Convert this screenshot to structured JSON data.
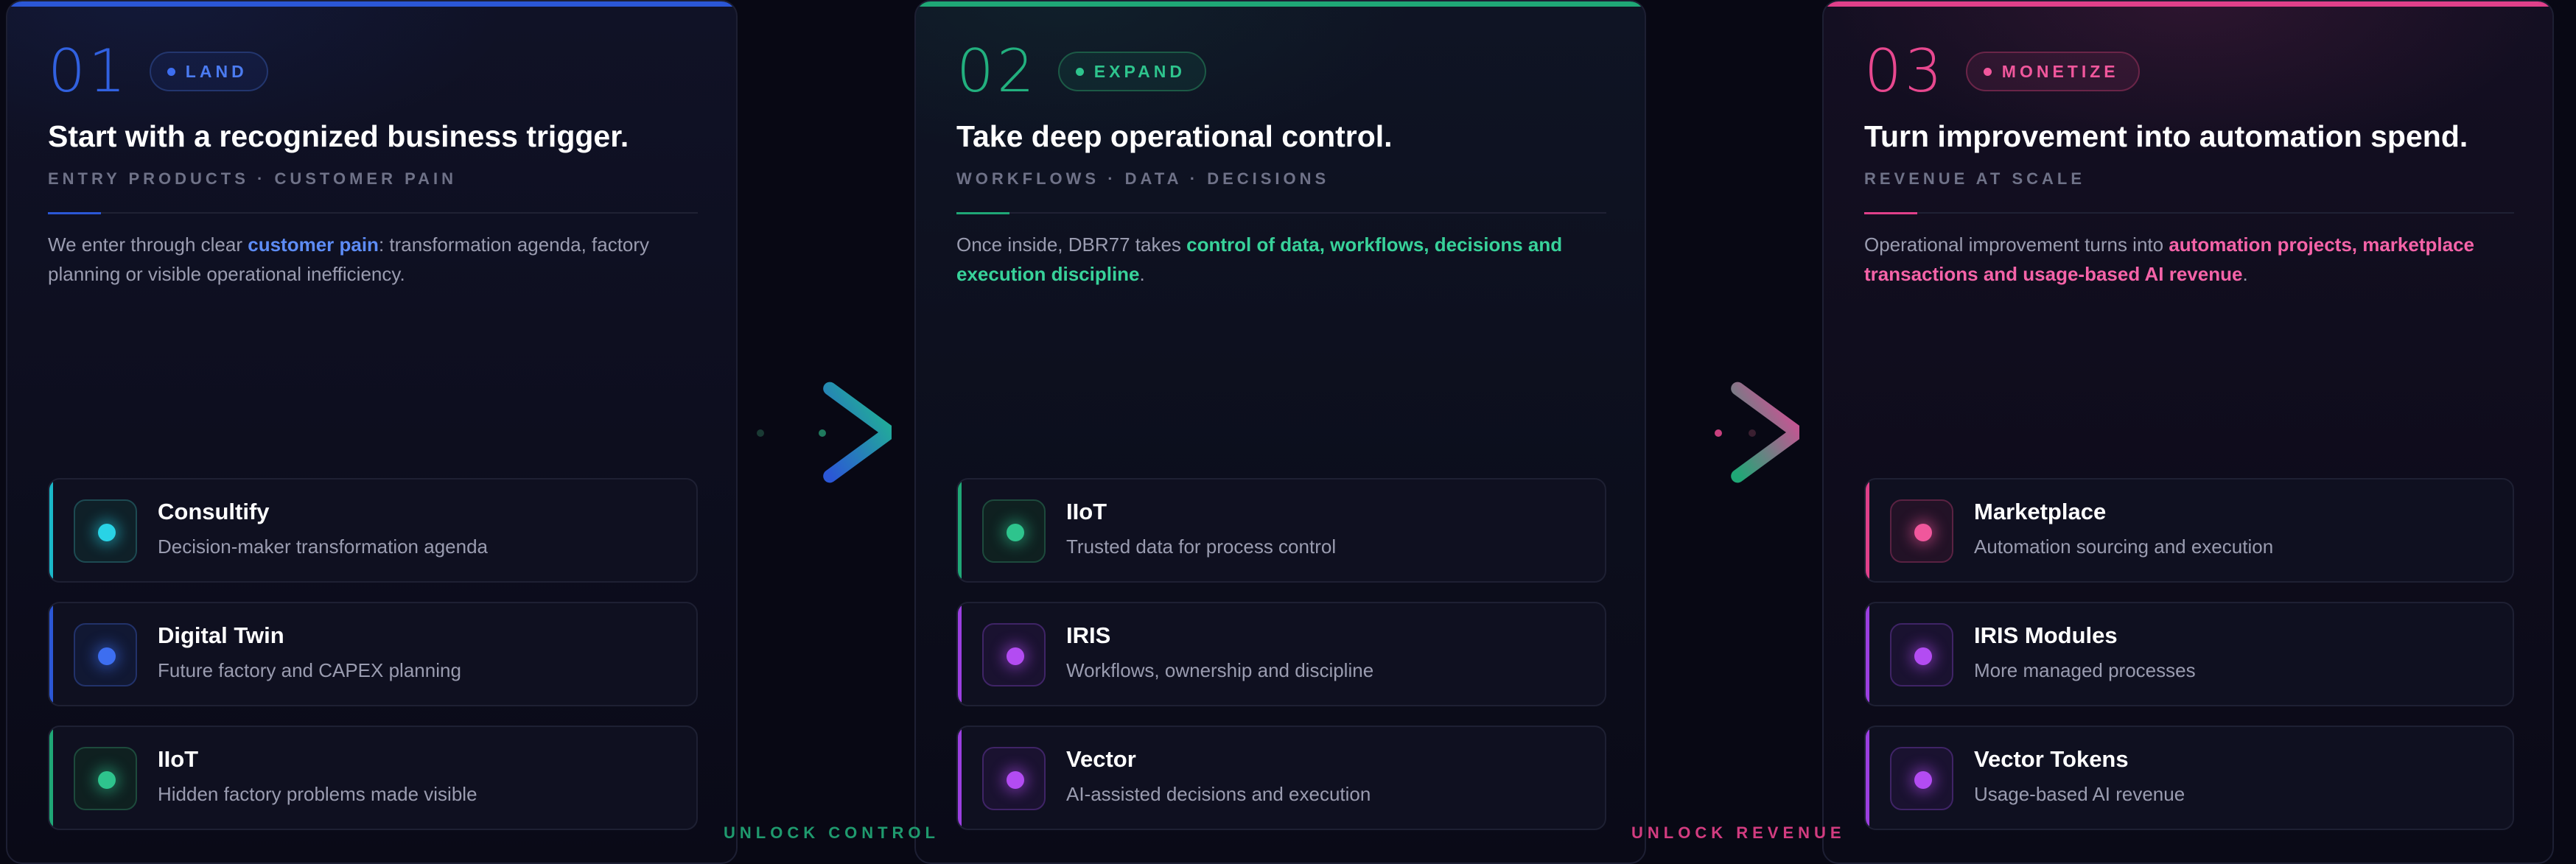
{
  "stages": [
    {
      "number": "01",
      "badge": "LAND",
      "title": "Start with a recognized business trigger.",
      "subtitle": "ENTRY PRODUCTS · CUSTOMER PAIN",
      "desc_pre": "We enter through clear ",
      "desc_hl": "customer pain",
      "desc_post": ": transformation agenda, factory planning or visible operational inefficiency.",
      "accent": "#2b57d6",
      "items": [
        {
          "name": "Consultify",
          "sub": "Decision-maker transformation agenda",
          "color": "cyan"
        },
        {
          "name": "Digital Twin",
          "sub": "Future factory and CAPEX planning",
          "color": "blue"
        },
        {
          "name": "IIoT",
          "sub": "Hidden factory problems made visible",
          "color": "green"
        }
      ]
    },
    {
      "number": "02",
      "badge": "EXPAND",
      "title": "Take deep operational control.",
      "subtitle": "WORKFLOWS · DATA · DECISIONS",
      "desc_pre": "Once inside, DBR77 takes ",
      "desc_hl": "control of data, workflows, decisions and execution discipline",
      "desc_post": ".",
      "accent": "#1fa776",
      "items": [
        {
          "name": "IIoT",
          "sub": "Trusted data for process control",
          "color": "green"
        },
        {
          "name": "IRIS",
          "sub": "Workflows, ownership and discipline",
          "color": "purple"
        },
        {
          "name": "Vector",
          "sub": "AI-assisted decisions and execution",
          "color": "purple"
        }
      ]
    },
    {
      "number": "03",
      "badge": "MONETIZE",
      "title": "Turn improvement into automation spend.",
      "subtitle": "REVENUE AT SCALE",
      "desc_pre": "Operational improvement turns into ",
      "desc_hl": "automation projects, marketplace transactions and usage-based AI revenue",
      "desc_post": ".",
      "accent": "#e0408a",
      "items": [
        {
          "name": "Marketplace",
          "sub": "Automation sourcing and execution",
          "color": "pink"
        },
        {
          "name": "IRIS Modules",
          "sub": "More managed processes",
          "color": "purple"
        },
        {
          "name": "Vector Tokens",
          "sub": "Usage-based AI revenue",
          "color": "purple"
        }
      ]
    }
  ],
  "connectors": [
    {
      "label": "UNLOCK CONTROL",
      "icon": "chevron-right-icon",
      "from": "#2b57d6",
      "to": "#1fa776"
    },
    {
      "label": "UNLOCK REVENUE",
      "icon": "chevron-right-icon",
      "from": "#1fa776",
      "to": "#e0408a"
    }
  ]
}
